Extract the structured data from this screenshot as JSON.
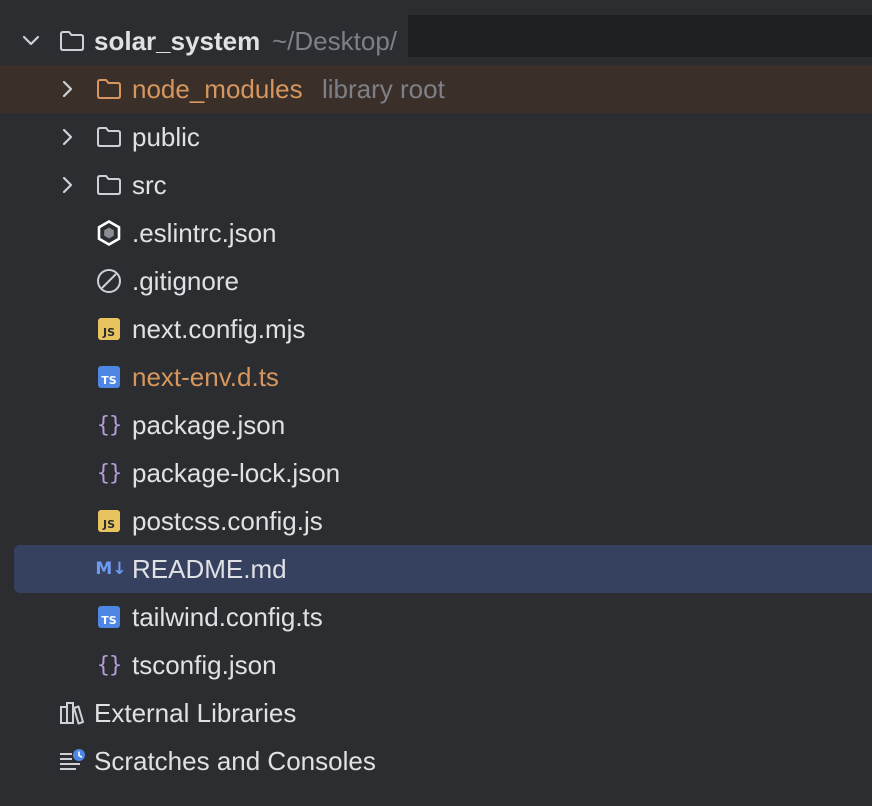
{
  "project": {
    "name": "solar_system",
    "path": "~/Desktop/"
  },
  "items": [
    {
      "label": "node_modules",
      "hint": "library root",
      "type": "folder",
      "icon": "folder-icon"
    },
    {
      "label": "public",
      "type": "folder",
      "icon": "folder-icon"
    },
    {
      "label": "src",
      "type": "folder",
      "icon": "folder-icon"
    },
    {
      "label": ".eslintrc.json",
      "type": "file",
      "icon": "eslint-icon"
    },
    {
      "label": ".gitignore",
      "type": "file",
      "icon": "ignore-icon"
    },
    {
      "label": "next.config.mjs",
      "type": "file",
      "icon": "js-file-icon",
      "badge": "JS"
    },
    {
      "label": "next-env.d.ts",
      "type": "file",
      "icon": "ts-file-icon",
      "badge": "TS"
    },
    {
      "label": "package.json",
      "type": "file",
      "icon": "json-icon",
      "glyph": "{}"
    },
    {
      "label": "package-lock.json",
      "type": "file",
      "icon": "json-icon",
      "glyph": "{}"
    },
    {
      "label": "postcss.config.js",
      "type": "file",
      "icon": "js-file-icon",
      "badge": "JS"
    },
    {
      "label": "README.md",
      "type": "file",
      "icon": "markdown-icon",
      "glyph": "M↓"
    },
    {
      "label": "tailwind.config.ts",
      "type": "file",
      "icon": "ts-file-icon",
      "badge": "TS"
    },
    {
      "label": "tsconfig.json",
      "type": "file",
      "icon": "json-icon",
      "glyph": "{}"
    }
  ],
  "external_libraries": {
    "label": "External Libraries",
    "icon": "libraries-icon"
  },
  "scratches": {
    "label": "Scratches and Consoles",
    "icon": "scratches-icon"
  },
  "colors": {
    "background": "#2b2d30",
    "selection": "#364160",
    "library_root_row": "#3a3029",
    "excluded_text": "#d6965e",
    "text": "#dfe1e5",
    "hint_text": "#7d8088"
  },
  "selected_item": "README.md"
}
